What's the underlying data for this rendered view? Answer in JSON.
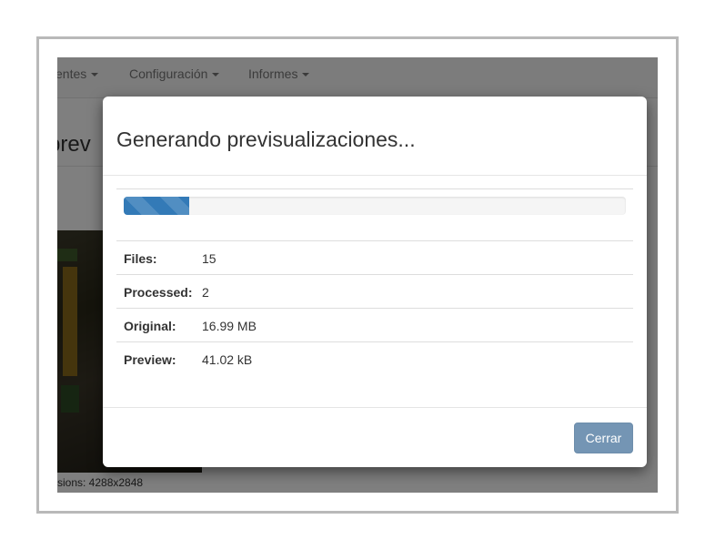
{
  "navbar": {
    "items": [
      {
        "label": "entes"
      },
      {
        "label": "Configuración"
      },
      {
        "label": "Informes"
      }
    ]
  },
  "background": {
    "title": "prev",
    "dimensions": "sions: 4288x2848"
  },
  "modal": {
    "title": "Generando previsualizaciones...",
    "progress": {
      "value": 2,
      "max": 15,
      "fraction": 0.13
    },
    "stats": [
      {
        "label": "Files:",
        "value": "15"
      },
      {
        "label": "Processed:",
        "value": "2"
      },
      {
        "label": "Original:",
        "value": "16.99 MB"
      },
      {
        "label": "Preview:",
        "value": "41.02 kB"
      }
    ],
    "close_label": "Cerrar"
  },
  "colors": {
    "progress_bar": "#337ab7",
    "close_button": "#7495b4",
    "backdrop": "rgba(0,0,0,0.5)"
  }
}
